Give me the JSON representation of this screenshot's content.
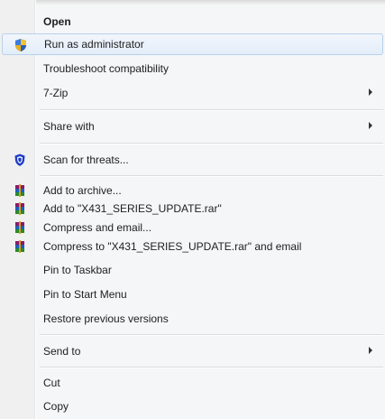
{
  "menu": {
    "items": [
      {
        "label": "Open"
      },
      {
        "label": "Run as administrator",
        "icon": "uac-shield-icon"
      },
      {
        "label": "Troubleshoot compatibility"
      },
      {
        "label": "7-Zip",
        "has_submenu": true
      },
      {
        "label": "Share with",
        "has_submenu": true
      },
      {
        "label": "Scan for threats...",
        "icon": "antivirus-shield-icon"
      },
      {
        "label": "Add to archive...",
        "icon": "winrar-icon"
      },
      {
        "label": "Add to \"X431_SERIES_UPDATE.rar\"",
        "icon": "winrar-icon"
      },
      {
        "label": "Compress and email...",
        "icon": "winrar-icon"
      },
      {
        "label": "Compress to \"X431_SERIES_UPDATE.rar\" and email",
        "icon": "winrar-icon"
      },
      {
        "label": "Pin to Taskbar"
      },
      {
        "label": "Pin to Start Menu"
      },
      {
        "label": "Restore previous versions"
      },
      {
        "label": "Send to",
        "has_submenu": true
      },
      {
        "label": "Cut"
      },
      {
        "label": "Copy"
      }
    ],
    "highlighted_item": "Run as administrator",
    "colors": {
      "background": "#f4f6f7",
      "hover_fill": "#e3edf9",
      "hover_border": "#b8d0ec",
      "separator": "#dcdcdc"
    }
  }
}
